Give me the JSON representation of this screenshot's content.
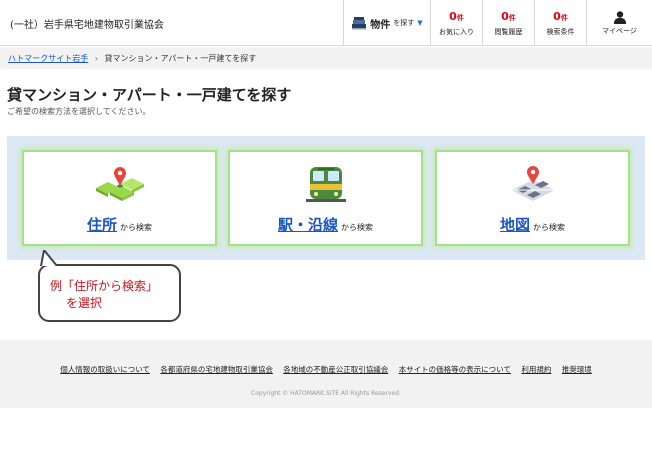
{
  "header": {
    "site_name": "(一社）岩手県宅地建物取引業協会",
    "search": {
      "main": "物件",
      "sub": "を探す"
    },
    "favorites": {
      "count": "0",
      "unit": "件",
      "label": "お気に入り"
    },
    "history": {
      "count": "0",
      "unit": "件",
      "label": "閲覧履歴"
    },
    "conditions": {
      "count": "0",
      "unit": "件",
      "label": "検索条件"
    },
    "mypage": {
      "label": "マイページ"
    }
  },
  "breadcrumb": {
    "home": "ハトマークサイト岩手",
    "separator": "›",
    "current": "貸マンション・アパート・一戸建てを探す"
  },
  "page": {
    "title": "貸マンション・アパート・一戸建てを探す",
    "subtitle": "ご希望の検索方法を選択してください。"
  },
  "search_options": [
    {
      "main": "住所",
      "suffix": "から検索",
      "icon": "address-map-icon"
    },
    {
      "main": "駅・沿線",
      "suffix": "から検索",
      "icon": "train-icon"
    },
    {
      "main": "地図",
      "suffix": "から検索",
      "icon": "map-icon"
    }
  ],
  "callout": {
    "line1": "例「住所から検索」",
    "line2": "を選択"
  },
  "footer": {
    "links": [
      "個人情報の取扱いについて",
      "各都道府県の宅地建物取引業協会",
      "各地域の不動産公正取引協議会",
      "本サイトの価格等の表示について",
      "利用規約",
      "推奨環境"
    ],
    "copyright": "Copyright © HATOMARK.SITE All Rights Reserved."
  },
  "colors": {
    "accent_blue": "#1a56c4",
    "count_red": "#e60012",
    "card_border_green": "#a6e08a",
    "panel_bg": "#dce8f5",
    "callout_text": "#d0121b"
  }
}
